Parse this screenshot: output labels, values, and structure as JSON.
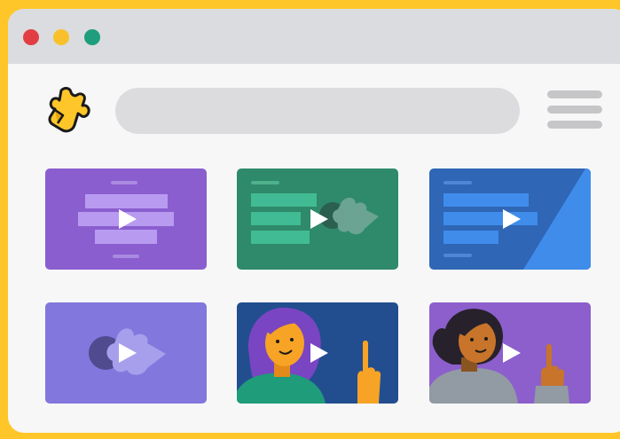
{
  "colors": {
    "background": "#FFC62A",
    "window": "#F7F7F7",
    "titlebar": "#DADCDF",
    "dot_red": "#E33D44",
    "dot_yellow": "#F8C12C",
    "dot_green": "#1E9E7C",
    "search_bar": "#DCDCDE",
    "menu_lines": "#C6C6C8"
  },
  "icons": {
    "logo": "puzzle-piece-logo-icon",
    "menu": "hamburger-menu-icon",
    "play": "play-icon"
  },
  "videos": [
    {
      "theme": "purple-lines",
      "bg": "#8A5ECF"
    },
    {
      "theme": "green-lines-puzzle",
      "bg": "#2E8A6A"
    },
    {
      "theme": "blue-lines-split",
      "bg": "#2F66B5"
    },
    {
      "theme": "lavender-puzzle",
      "bg": "#8277DC"
    },
    {
      "theme": "woman-pointing-blue",
      "bg": "#224E8F"
    },
    {
      "theme": "woman-pointing-purple",
      "bg": "#8C5FCC"
    }
  ]
}
